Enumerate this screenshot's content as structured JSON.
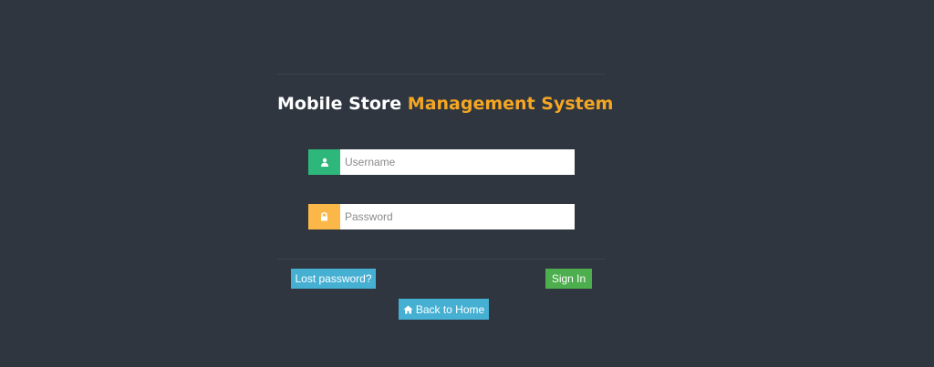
{
  "header": {
    "title_part1": "Mobile Store",
    "title_part2": "Management System"
  },
  "form": {
    "username_placeholder": "Username",
    "password_placeholder": "Password",
    "username_icon": "user-icon",
    "password_icon": "lock-icon"
  },
  "actions": {
    "lost_password_label": "Lost password?",
    "sign_in_label": "Sign In",
    "back_home_label": "Back to Home",
    "back_home_icon": "home-icon"
  },
  "colors": {
    "background": "#2f3640",
    "title_accent": "#f5a623",
    "user_addon": "#2eb77a",
    "lock_addon": "#fbb848",
    "info_button": "#46b0d3",
    "success_button": "#4cae4c"
  }
}
